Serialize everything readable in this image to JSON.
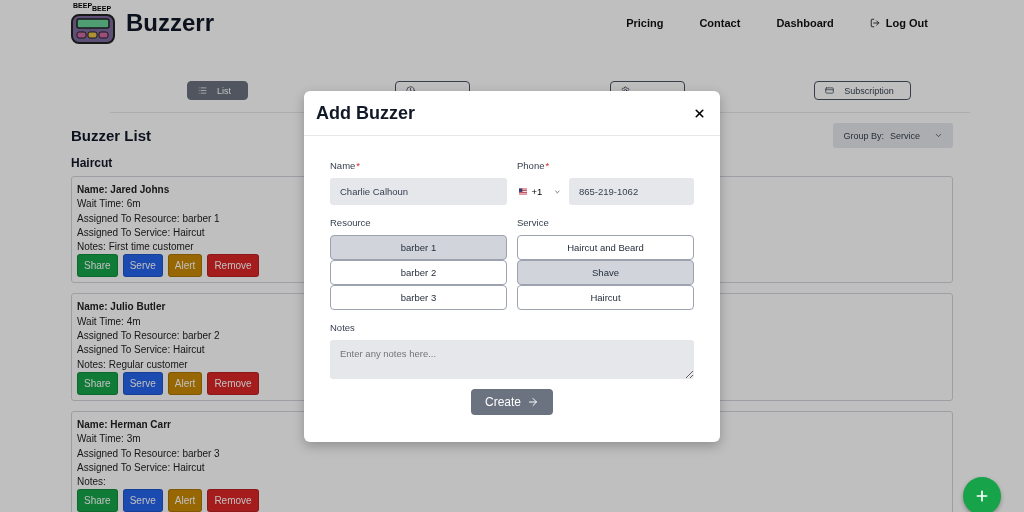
{
  "header": {
    "logo_words": [
      "BEEP",
      "BEEP"
    ],
    "brand": "Buzzerr",
    "nav": [
      "Pricing",
      "Contact",
      "Dashboard"
    ],
    "logout": "Log Out"
  },
  "tabs": [
    {
      "label": "List",
      "selected": true,
      "kind": "list"
    },
    {
      "selected": false,
      "kind": "recent"
    },
    {
      "selected": false,
      "kind": "settings"
    },
    {
      "label": "Subscription",
      "selected": false,
      "kind": "subscription"
    }
  ],
  "list": {
    "title": "Buzzer List",
    "group_by_label": "Group By:",
    "group_by_value": "Service",
    "groups": [
      {
        "name": "Haircut",
        "buzzers": [
          {
            "lines": [
              "Name: Jared Johns",
              "Wait Time: 6m",
              "Assigned To Resource: barber 1",
              "Assigned To Service: Haircut",
              "Notes: First time customer"
            ],
            "actions": [
              {
                "label": "Share",
                "kind": "share"
              },
              {
                "label": "Serve",
                "kind": "serve"
              },
              {
                "label": "Alert",
                "kind": "alert"
              },
              {
                "label": "Remove",
                "kind": "remove"
              }
            ]
          },
          {
            "lines": [
              "Name: Julio Butler",
              "Wait Time: 4m",
              "Assigned To Resource: barber 2",
              "Assigned To Service: Haircut",
              "Notes: Regular customer"
            ],
            "actions": [
              {
                "label": "Share",
                "kind": "share"
              },
              {
                "label": "Serve",
                "kind": "serve"
              },
              {
                "label": "Alert",
                "kind": "alert"
              },
              {
                "label": "Remove",
                "kind": "remove"
              }
            ]
          },
          {
            "lines": [
              "Name: Herman Carr",
              "Wait Time: 3m",
              "Assigned To Resource: barber 3",
              "Assigned To Service: Haircut",
              "Notes:"
            ],
            "actions": [
              {
                "label": "Share",
                "kind": "share"
              },
              {
                "label": "Serve",
                "kind": "serve"
              },
              {
                "label": "Alert",
                "kind": "alert"
              },
              {
                "label": "Remove",
                "kind": "remove"
              }
            ]
          }
        ]
      }
    ]
  },
  "modal": {
    "title": "Add Buzzer",
    "name": {
      "label": "Name",
      "required_mark": "*",
      "value": "Charlie Calhoun"
    },
    "phone": {
      "label": "Phone",
      "required_mark": "*",
      "country_code": "+1",
      "value": "865-219-1062"
    },
    "resource": {
      "label": "Resource",
      "options": [
        {
          "label": "barber 1",
          "selected": true
        },
        {
          "label": "barber 2",
          "selected": false
        },
        {
          "label": "barber 3",
          "selected": false
        }
      ]
    },
    "service": {
      "label": "Service",
      "options": [
        {
          "label": "Haircut and Beard",
          "selected": false
        },
        {
          "label": "Shave",
          "selected": true
        },
        {
          "label": "Haircut",
          "selected": false
        }
      ]
    },
    "notes": {
      "label": "Notes",
      "placeholder": "Enter any notes here..."
    },
    "submit": "Create"
  }
}
